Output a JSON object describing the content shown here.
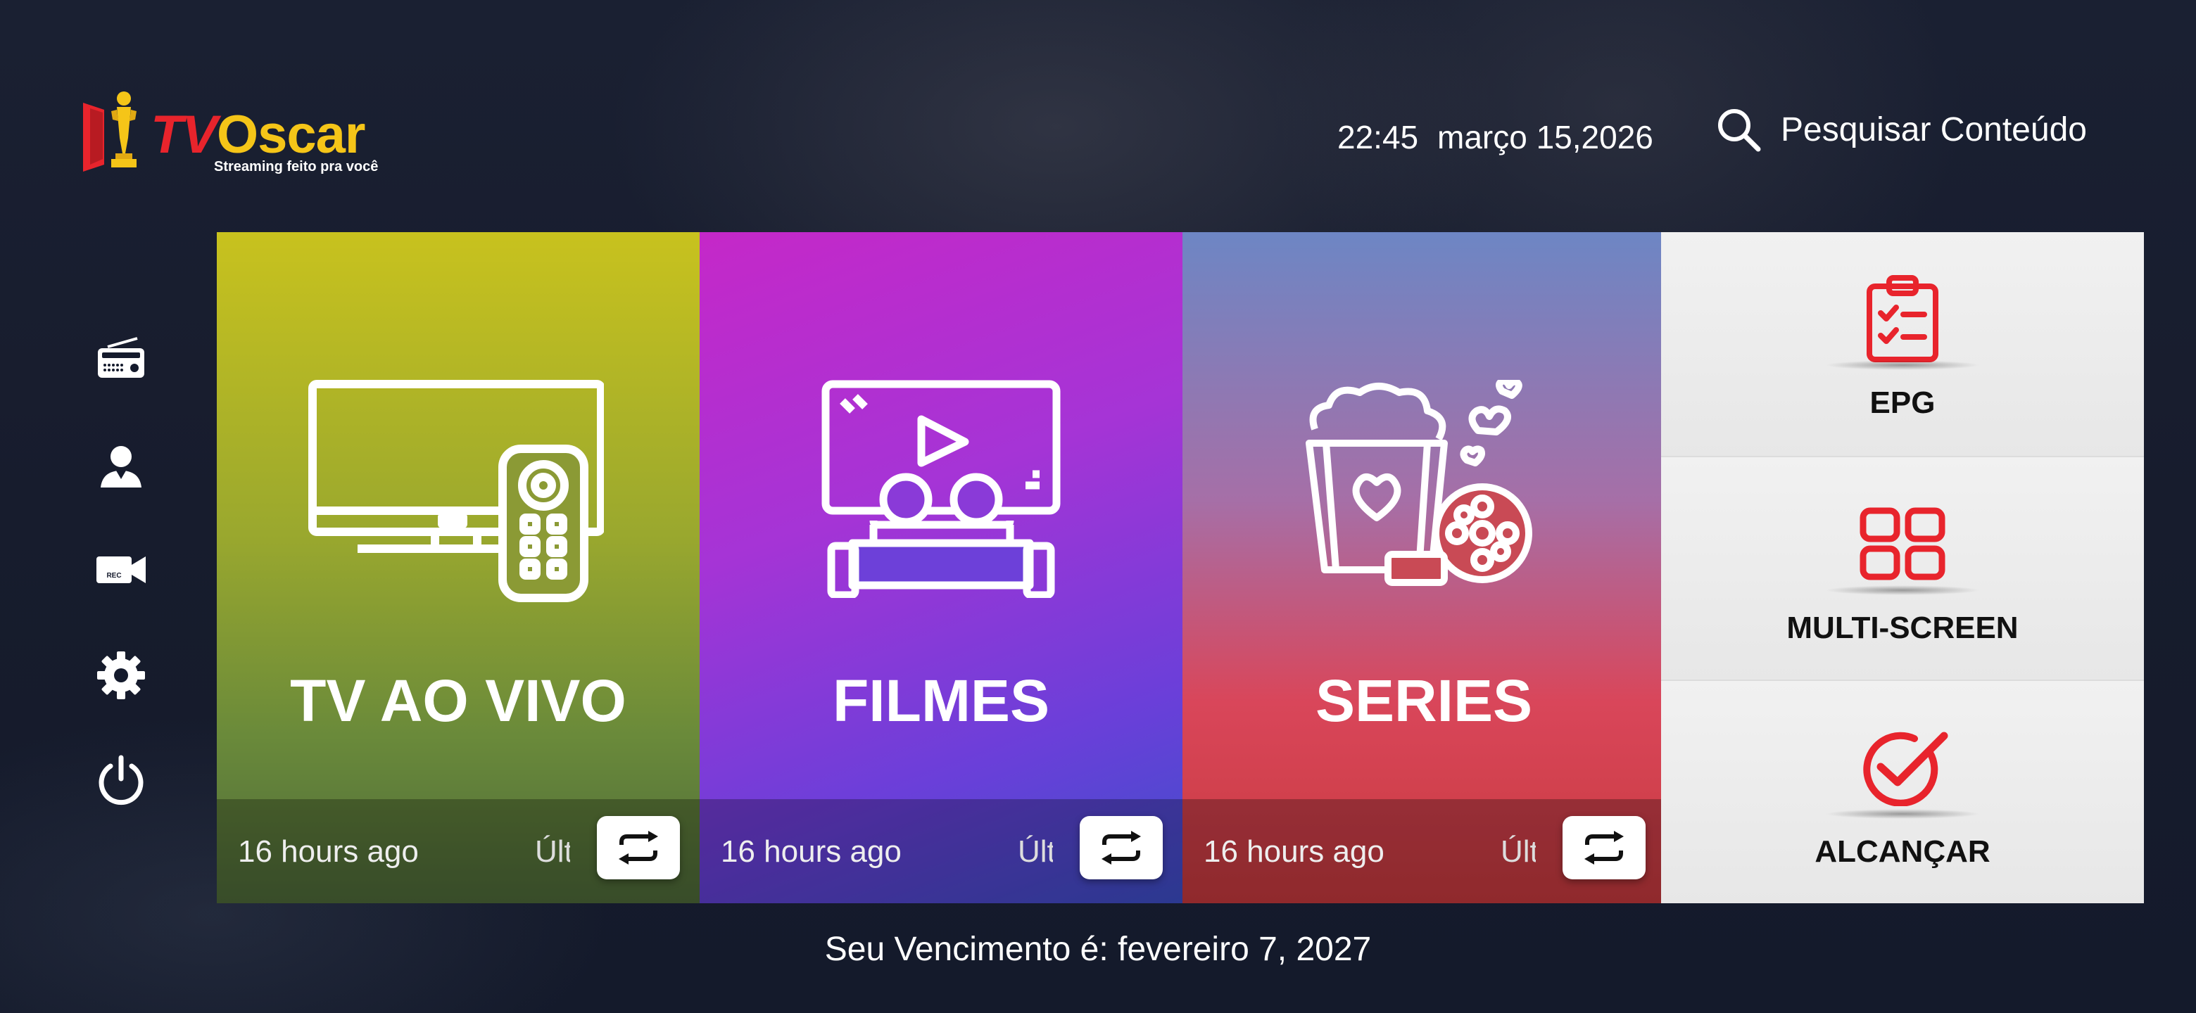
{
  "app": {
    "brand_tv": "TV",
    "brand_oscar": "Oscar",
    "tagline": "Streaming feito pra você"
  },
  "header": {
    "time": "22:45",
    "date": "março 15,2026",
    "search_label": "Pesquisar Conteúdo"
  },
  "sidebar": {
    "items": [
      {
        "icon": "radio-icon"
      },
      {
        "icon": "user-icon"
      },
      {
        "icon": "rec-camera-icon"
      },
      {
        "icon": "gear-icon"
      },
      {
        "icon": "power-icon"
      }
    ]
  },
  "tiles": [
    {
      "title": "TV AO VIVO",
      "updated": "16 hours ago",
      "last": "Últ",
      "icon": "tv-remote-icon"
    },
    {
      "title": "FILMES",
      "updated": "16 hours ago",
      "last": "Últ",
      "icon": "cinema-icon"
    },
    {
      "title": "SERIES",
      "updated": "16 hours ago",
      "last": "Últ",
      "icon": "popcorn-icon"
    }
  ],
  "right_menu": [
    {
      "label": "EPG",
      "icon": "clipboard-icon"
    },
    {
      "label": "MULTI-SCREEN",
      "icon": "grid-icon"
    },
    {
      "label": "ALCANÇAR",
      "icon": "check-circle-icon"
    }
  ],
  "footer": {
    "expiry": "Seu Vencimento é: fevereiro 7, 2027"
  },
  "colors": {
    "accent_red": "#e8242c",
    "brand_yellow": "#f5c518",
    "background": "#141a2c"
  }
}
